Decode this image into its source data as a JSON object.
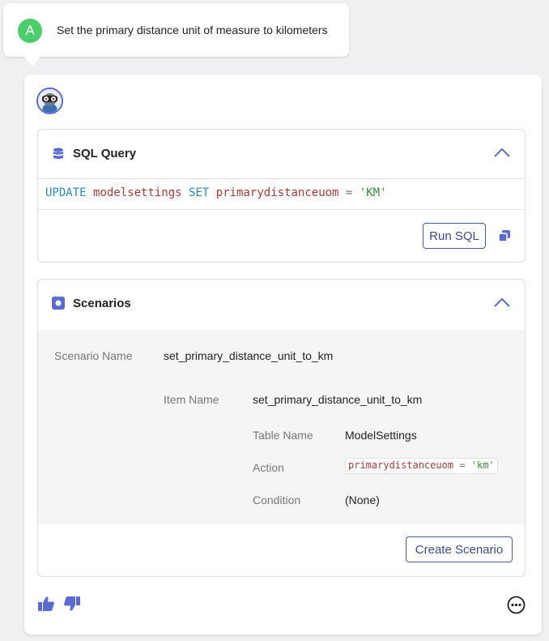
{
  "user_message": {
    "avatar_letter": "A",
    "text": "Set the primary distance unit of measure to kilometers"
  },
  "sql_panel": {
    "title": "SQL Query",
    "icon": "database-icon",
    "code": {
      "kw1": "UPDATE",
      "table": "modelsettings",
      "kw2": "SET",
      "column": "primarydistanceuom",
      "op": "=",
      "value": "'KM'"
    },
    "run_label": "Run SQL",
    "copy_icon": "copy-icon",
    "collapse_icon": "chevron-up-icon"
  },
  "scenarios_panel": {
    "title": "Scenarios",
    "icon": "scenario-icon",
    "collapse_icon": "chevron-up-icon",
    "scenario_name_label": "Scenario Name",
    "scenario_name": "set_primary_distance_unit_to_km",
    "item_name_label": "Item Name",
    "item_name": "set_primary_distance_unit_to_km",
    "table_name_label": "Table Name",
    "table_name": "ModelSettings",
    "action_label": "Action",
    "action": {
      "column": "primarydistanceuom",
      "op": "=",
      "value": "'km'"
    },
    "condition_label": "Condition",
    "condition": "(None)",
    "create_label": "Create Scenario"
  },
  "feedback": {
    "thumbs_up_icon": "thumbs-up-icon",
    "thumbs_down_icon": "thumbs-down-icon",
    "more_icon": "more-options-icon"
  },
  "colors": {
    "accent": "#5b6bd0",
    "button_text": "#3d4a8a",
    "avatar_green": "#4cce6c",
    "sql_keyword": "#2b8ab7",
    "sql_identifier": "#a53b3b",
    "sql_string": "#3b8a3b"
  }
}
